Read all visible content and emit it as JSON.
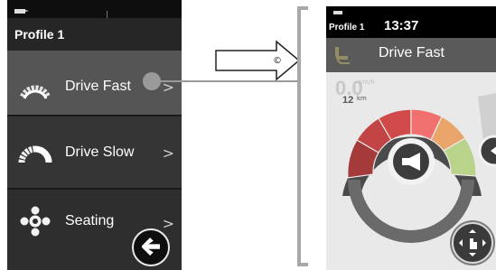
{
  "left_screen": {
    "profile_title": "Profile 1",
    "menu": [
      {
        "label": "Drive Fast",
        "icon": "speedometer-fast-icon",
        "selected": true
      },
      {
        "label": "Drive Slow",
        "icon": "speedometer-slow-icon",
        "selected": false
      },
      {
        "label": "Seating",
        "icon": "seating-joystick-icon",
        "selected": false
      }
    ],
    "chevron": ">",
    "back_icon": "back-arrow-icon"
  },
  "arrow_symbol": "©",
  "right_screen": {
    "profile": "Profile 1",
    "time": "13:37",
    "title": "Drive Fast",
    "speed_value": "0.0",
    "speed_unit": "km/h",
    "distance_value": "12",
    "distance_unit": "km",
    "horn_icon": "horn-icon",
    "touch_icon": "touch-gesture-icon"
  },
  "colors": {
    "selected_row": "#555555",
    "gauge_red_dark": "#a53a3a",
    "gauge_red": "#d04a4a",
    "gauge_pink": "#f07070",
    "gauge_orange": "#e9a56a",
    "gauge_green": "#b9d48a"
  }
}
